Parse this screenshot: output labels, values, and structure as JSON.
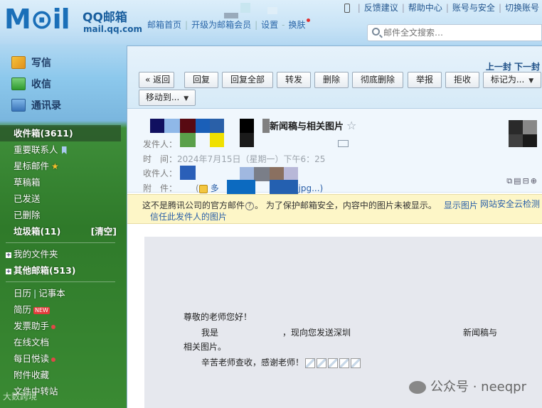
{
  "header": {
    "logo_big": "M⊙il",
    "logo_qq": "QQ邮箱",
    "logo_domain": "mail.qq.com",
    "links": [
      "邮箱首页",
      "开级为邮箱会员",
      "设置",
      "换肤"
    ],
    "top_right": [
      "反馈建议",
      "帮助中心",
      "账号与安全",
      "切换账号"
    ],
    "search_placeholder": "邮件全文搜索…"
  },
  "sidebar": {
    "write": "写信",
    "inbox": "收信",
    "contacts": "通讯录",
    "folders": [
      {
        "label": "收件箱(3611)"
      },
      {
        "label": "重要联系人"
      },
      {
        "label": "星标邮件"
      },
      {
        "label": "草稿箱"
      },
      {
        "label": "已发送"
      },
      {
        "label": "已删除"
      },
      {
        "label": "垃圾箱(11)",
        "action": "[清空]"
      }
    ],
    "my_folders": "我的文件夹",
    "other_mailboxes": "其他邮箱(513)",
    "apps": [
      {
        "label": "日历",
        "extra": "记事本"
      },
      {
        "label": "简历",
        "badge": "NEW"
      },
      {
        "label": "发票助手"
      },
      {
        "label": "在线文档"
      },
      {
        "label": "每日悦读"
      },
      {
        "label": "附件收藏"
      },
      {
        "label": "文件中转站"
      }
    ],
    "bottom_watermark": "大数跨境"
  },
  "toolbar": {
    "prev_next": "上一封 下一封",
    "buttons": [
      "« 返回",
      "回复",
      "回复全部",
      "转发",
      "删除",
      "彻底删除",
      "举报",
      "拒收"
    ],
    "mark_as": "标记为...",
    "move_to": "移动到..."
  },
  "message": {
    "subject": "新闻稿与相关图片",
    "from_label": "发件人：",
    "time_label": "时　间：",
    "time_value": "2024年7月15日（星期一）下午6：25",
    "to_label": "收件人：",
    "att_label": "附　件：",
    "att_prefix": "多",
    "att_suffix": "大.jpg...)"
  },
  "notice": {
    "text": "这不是腾讯公司的官方邮件",
    "text2": "。 为了保护邮箱安全，内容中的图片未被显示。",
    "show_images": "显示图片",
    "cloud_check": "网站安全云检测",
    "trust": "信任此发件人的图片"
  },
  "body": {
    "greeting": "尊敬的老师您好！",
    "line1": "我是",
    "line1_mid": "，现向您发送深圳",
    "line1_end": "新闻稿与",
    "line2": "相关图片。",
    "line3": "辛苦老师查收，感谢老师！"
  },
  "watermark": "公众号 · neeqpr",
  "colors": {
    "accent": "#1a6fb8",
    "link": "#2a5fa8",
    "notice_bg": "#fdf6c7"
  }
}
